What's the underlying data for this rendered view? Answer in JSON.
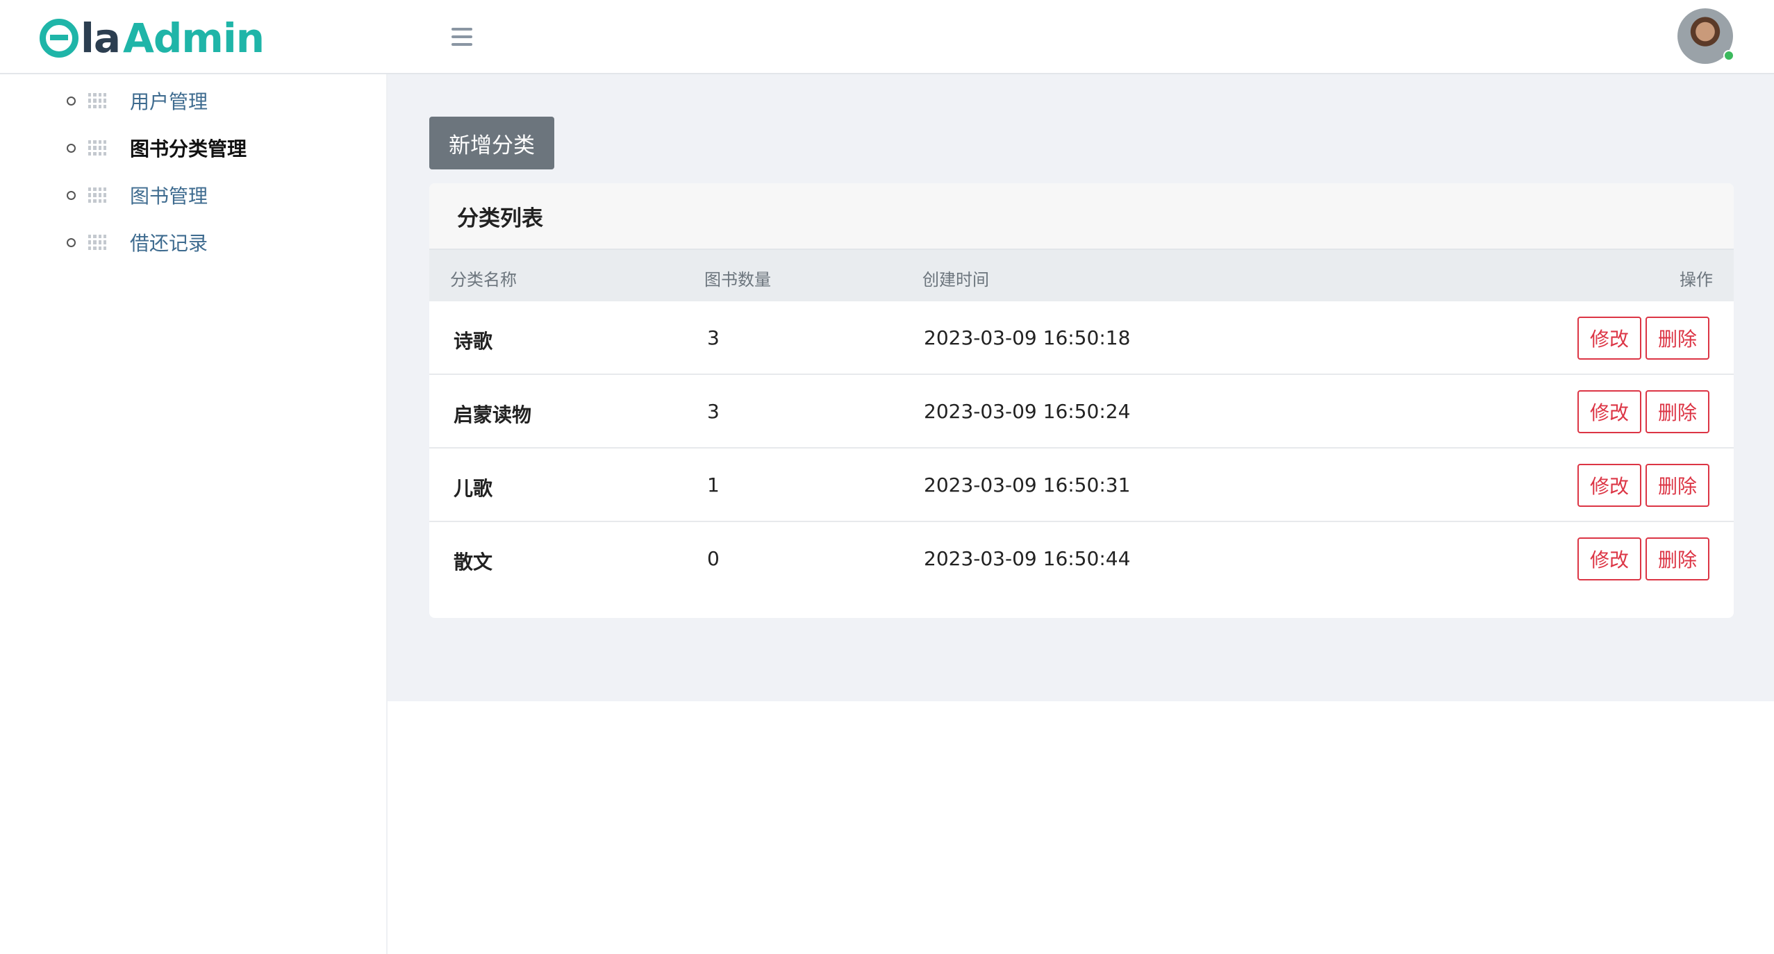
{
  "header": {
    "logo": {
      "part1": "la",
      "part2": "Admin"
    },
    "menu_toggle": "menu-icon",
    "avatar": "user-avatar",
    "status_color": "#3cb95d"
  },
  "sidebar": {
    "items": [
      {
        "label": "用户管理",
        "icon": "grid-icon",
        "active": false
      },
      {
        "label": "图书分类管理",
        "icon": "grid-icon",
        "active": true
      },
      {
        "label": "图书管理",
        "icon": "grid-icon",
        "active": false
      },
      {
        "label": "借还记录",
        "icon": "grid-icon",
        "active": false
      }
    ]
  },
  "main": {
    "add_button": "新增分类",
    "card_title": "分类列表",
    "columns": [
      "分类名称",
      "图书数量",
      "创建时间",
      "操作"
    ],
    "rows": [
      {
        "name": "诗歌",
        "count": "3",
        "created": "2023-03-09 16:50:18",
        "edit": "修改",
        "delete": "删除"
      },
      {
        "name": "启蒙读物",
        "count": "3",
        "created": "2023-03-09 16:50:24",
        "edit": "修改",
        "delete": "删除"
      },
      {
        "name": "儿歌",
        "count": "1",
        "created": "2023-03-09 16:50:31",
        "edit": "修改",
        "delete": "删除"
      },
      {
        "name": "散文",
        "count": "0",
        "created": "2023-03-09 16:50:44",
        "edit": "修改",
        "delete": "删除"
      }
    ]
  },
  "colors": {
    "brand": "#1fb5a8",
    "danger": "#dc3545",
    "secondary": "#6c757d",
    "background": "#f0f2f6"
  }
}
